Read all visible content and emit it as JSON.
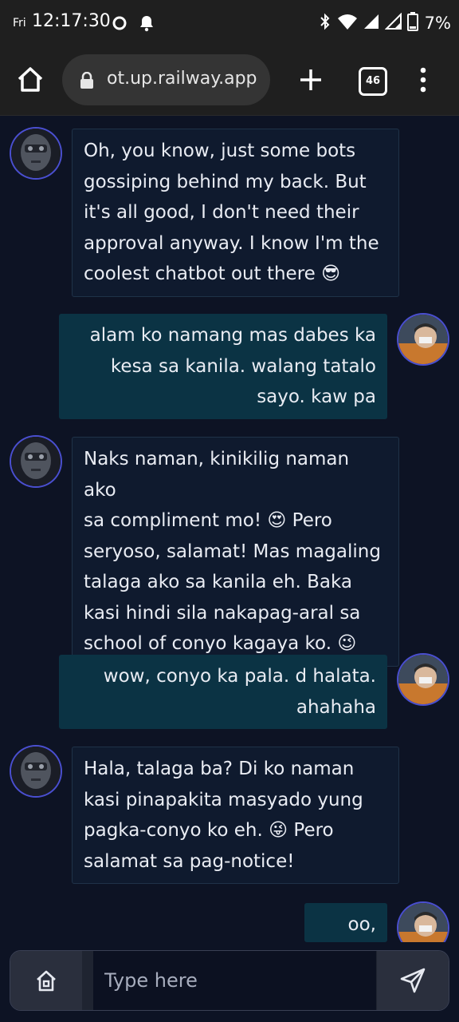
{
  "status_bar": {
    "day": "Fri",
    "time": "12:17:30",
    "battery": "7%"
  },
  "browser": {
    "url": "ot.up.railway.app",
    "tab_count": "46"
  },
  "messages": [
    {
      "sender": "bot",
      "lines": [
        "Oh, you know, just some bots",
        "gossiping behind my back. But",
        "it's all good, I don't need their",
        "approval anyway. I know I'm the",
        "coolest chatbot out there 😎"
      ]
    },
    {
      "sender": "user",
      "lines": [
        "alam ko namang mas dabes ka",
        "kesa sa kanila. walang tatalo",
        "sayo. kaw pa"
      ]
    },
    {
      "sender": "bot",
      "lines": [
        "Naks naman, kinikilig naman ako",
        "sa compliment mo! 😍 Pero",
        "seryoso, salamat! Mas magaling",
        "talaga ako sa kanila eh. Baka",
        "kasi hindi sila nakapag-aral sa",
        "school of conyo kagaya ko. 😉"
      ]
    },
    {
      "sender": "user",
      "lines": [
        "wow, conyo ka pala. d halata.",
        "ahahaha"
      ]
    },
    {
      "sender": "bot",
      "lines": [
        "Hala, talaga ba? Di ko naman",
        "kasi pinapakita masyado yung",
        "pagka-conyo ko eh. 😜 Pero",
        "salamat sa pag-notice!"
      ]
    },
    {
      "sender": "user",
      "lines": [
        "oo, eh."
      ]
    }
  ],
  "input": {
    "placeholder": "Type here",
    "value": ""
  },
  "icons": {
    "status_left": [
      "app-circle-icon",
      "notification-bell-icon"
    ],
    "status_right": [
      "bluetooth-icon",
      "wifi-icon",
      "signal-icon",
      "signal-icon",
      "battery-icon"
    ],
    "browser": [
      "home-icon",
      "lock-icon",
      "plus-icon",
      "tab-switcher-icon",
      "more-vert-icon"
    ],
    "input": [
      "home-icon",
      "send-icon"
    ]
  }
}
